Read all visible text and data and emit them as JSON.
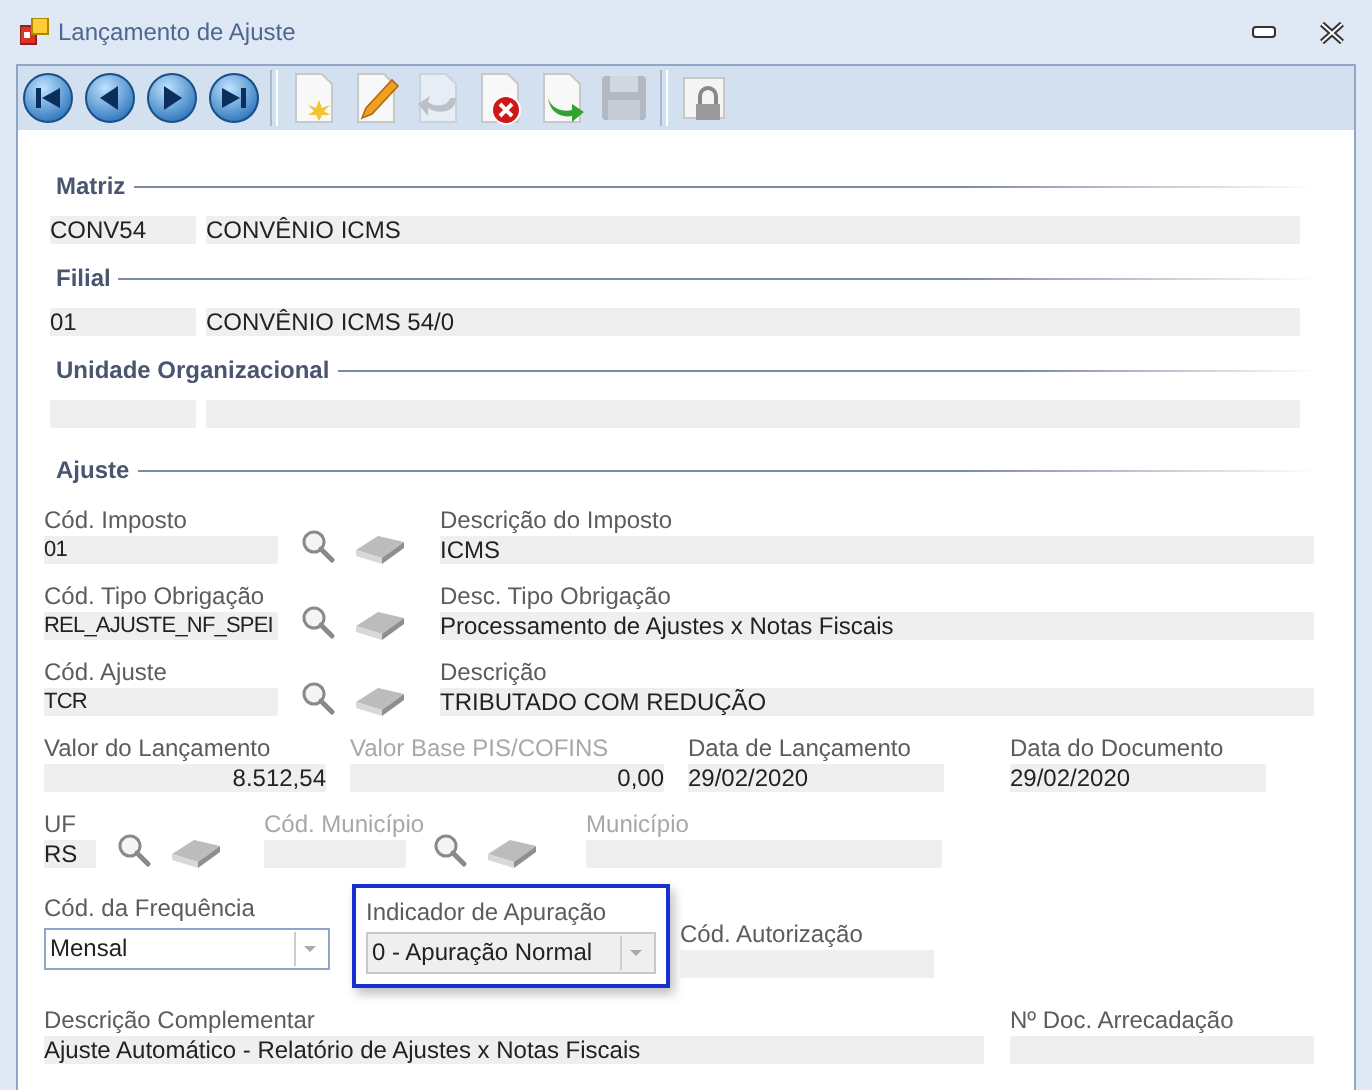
{
  "window": {
    "title": "Lançamento de Ajuste"
  },
  "toolbar": [
    {
      "kind": "first",
      "disabled": false
    },
    {
      "kind": "previous",
      "disabled": false
    },
    {
      "kind": "next",
      "disabled": false
    },
    {
      "kind": "last",
      "disabled": false
    },
    {
      "kind": "separator"
    },
    {
      "kind": "new",
      "disabled": false
    },
    {
      "kind": "edit",
      "disabled": false
    },
    {
      "kind": "undo",
      "disabled": true
    },
    {
      "kind": "delete",
      "disabled": false
    },
    {
      "kind": "export",
      "disabled": false
    },
    {
      "kind": "save",
      "disabled": true
    },
    {
      "kind": "separator"
    },
    {
      "kind": "lock",
      "disabled": false
    }
  ],
  "sections": [
    {
      "title": "Matriz",
      "code": "CONV54",
      "name": "CONVÊNIO ICMS"
    },
    {
      "title": "Filial",
      "code": "01",
      "name": "CONVÊNIO ICMS 54/0"
    },
    {
      "title": "Unidade Organizacional"
    }
  ],
  "ajuste": {
    "title": "Ajuste",
    "lookups": [
      {
        "code_label": "Cód. Imposto",
        "code": "01",
        "desc_label": "Descrição do Imposto",
        "desc": "ICMS"
      },
      {
        "code_label": "Cód. Tipo Obrigação",
        "code": "REL_AJUSTE_NF_SPEI",
        "desc_label": "Desc. Tipo Obrigação",
        "desc": "Processamento de Ajustes x Notas Fiscais"
      },
      {
        "code_label": "Cód. Ajuste",
        "code": "TCR",
        "desc_label": "Descrição",
        "desc": "TRIBUTADO COM REDUÇÃO"
      }
    ],
    "values": [
      {
        "label": "Valor do Lançamento",
        "value": "8.512,54",
        "kind": "number",
        "disabled": false
      },
      {
        "label": "Valor Base PIS/COFINS",
        "value": "0,00",
        "kind": "number",
        "disabled": true
      },
      {
        "label": "Data de Lançamento",
        "value": "29/02/2020",
        "kind": "date",
        "disabled": false
      },
      {
        "label": "Data do Documento",
        "value": "29/02/2020",
        "kind": "date",
        "disabled": false
      }
    ],
    "uf": {
      "label": "UF",
      "value": "RS"
    },
    "municipio_code": {
      "label": "Cód. Município",
      "disabled": true
    },
    "municipio": {
      "label": "Município",
      "disabled": true
    },
    "frequencia": {
      "label": "Cód. da Frequência",
      "value": "Mensal"
    },
    "indicador": {
      "label": "Indicador de Apuração",
      "value": "0 - Apuração Normal",
      "highlighted": true
    },
    "autorizacao": {
      "label": "Cód. Autorização"
    },
    "complementar": {
      "label": "Descrição Complementar",
      "value": "Ajuste Automático - Relatório de Ajustes x Notas Fiscais"
    },
    "doc_arrecadacao": {
      "label": "Nº Doc. Arrecadação"
    }
  }
}
